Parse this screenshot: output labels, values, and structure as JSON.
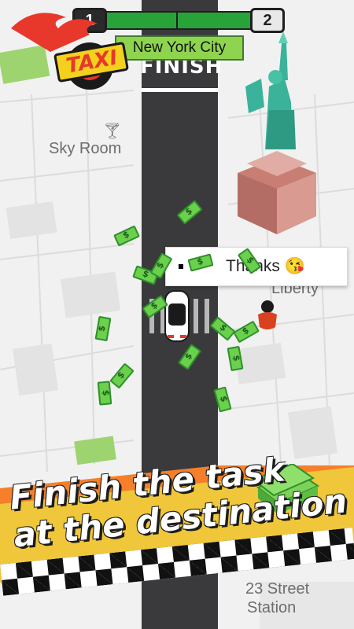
{
  "logo": {
    "text": "TAXI",
    "icon": "taxi-logo-icon"
  },
  "progress": {
    "current_level": "1",
    "next_level": "2",
    "color": "#27a33a"
  },
  "city": {
    "name": "New York City"
  },
  "road": {
    "finish_text": "FINISH"
  },
  "map_labels": {
    "sky_room": "Sky Room",
    "liberty": "Liberty",
    "station_line1": "23 Street",
    "station_line2": "Station"
  },
  "bubble": {
    "text": "Thanks 😘"
  },
  "banner": {
    "line1": "Finish the task",
    "line2": "at the destination"
  },
  "icons": [
    "cocktail-icon",
    "statue-of-liberty-icon",
    "taxi-car-icon",
    "passenger-icon",
    "money-stack-icon",
    "money-bill-icon"
  ]
}
